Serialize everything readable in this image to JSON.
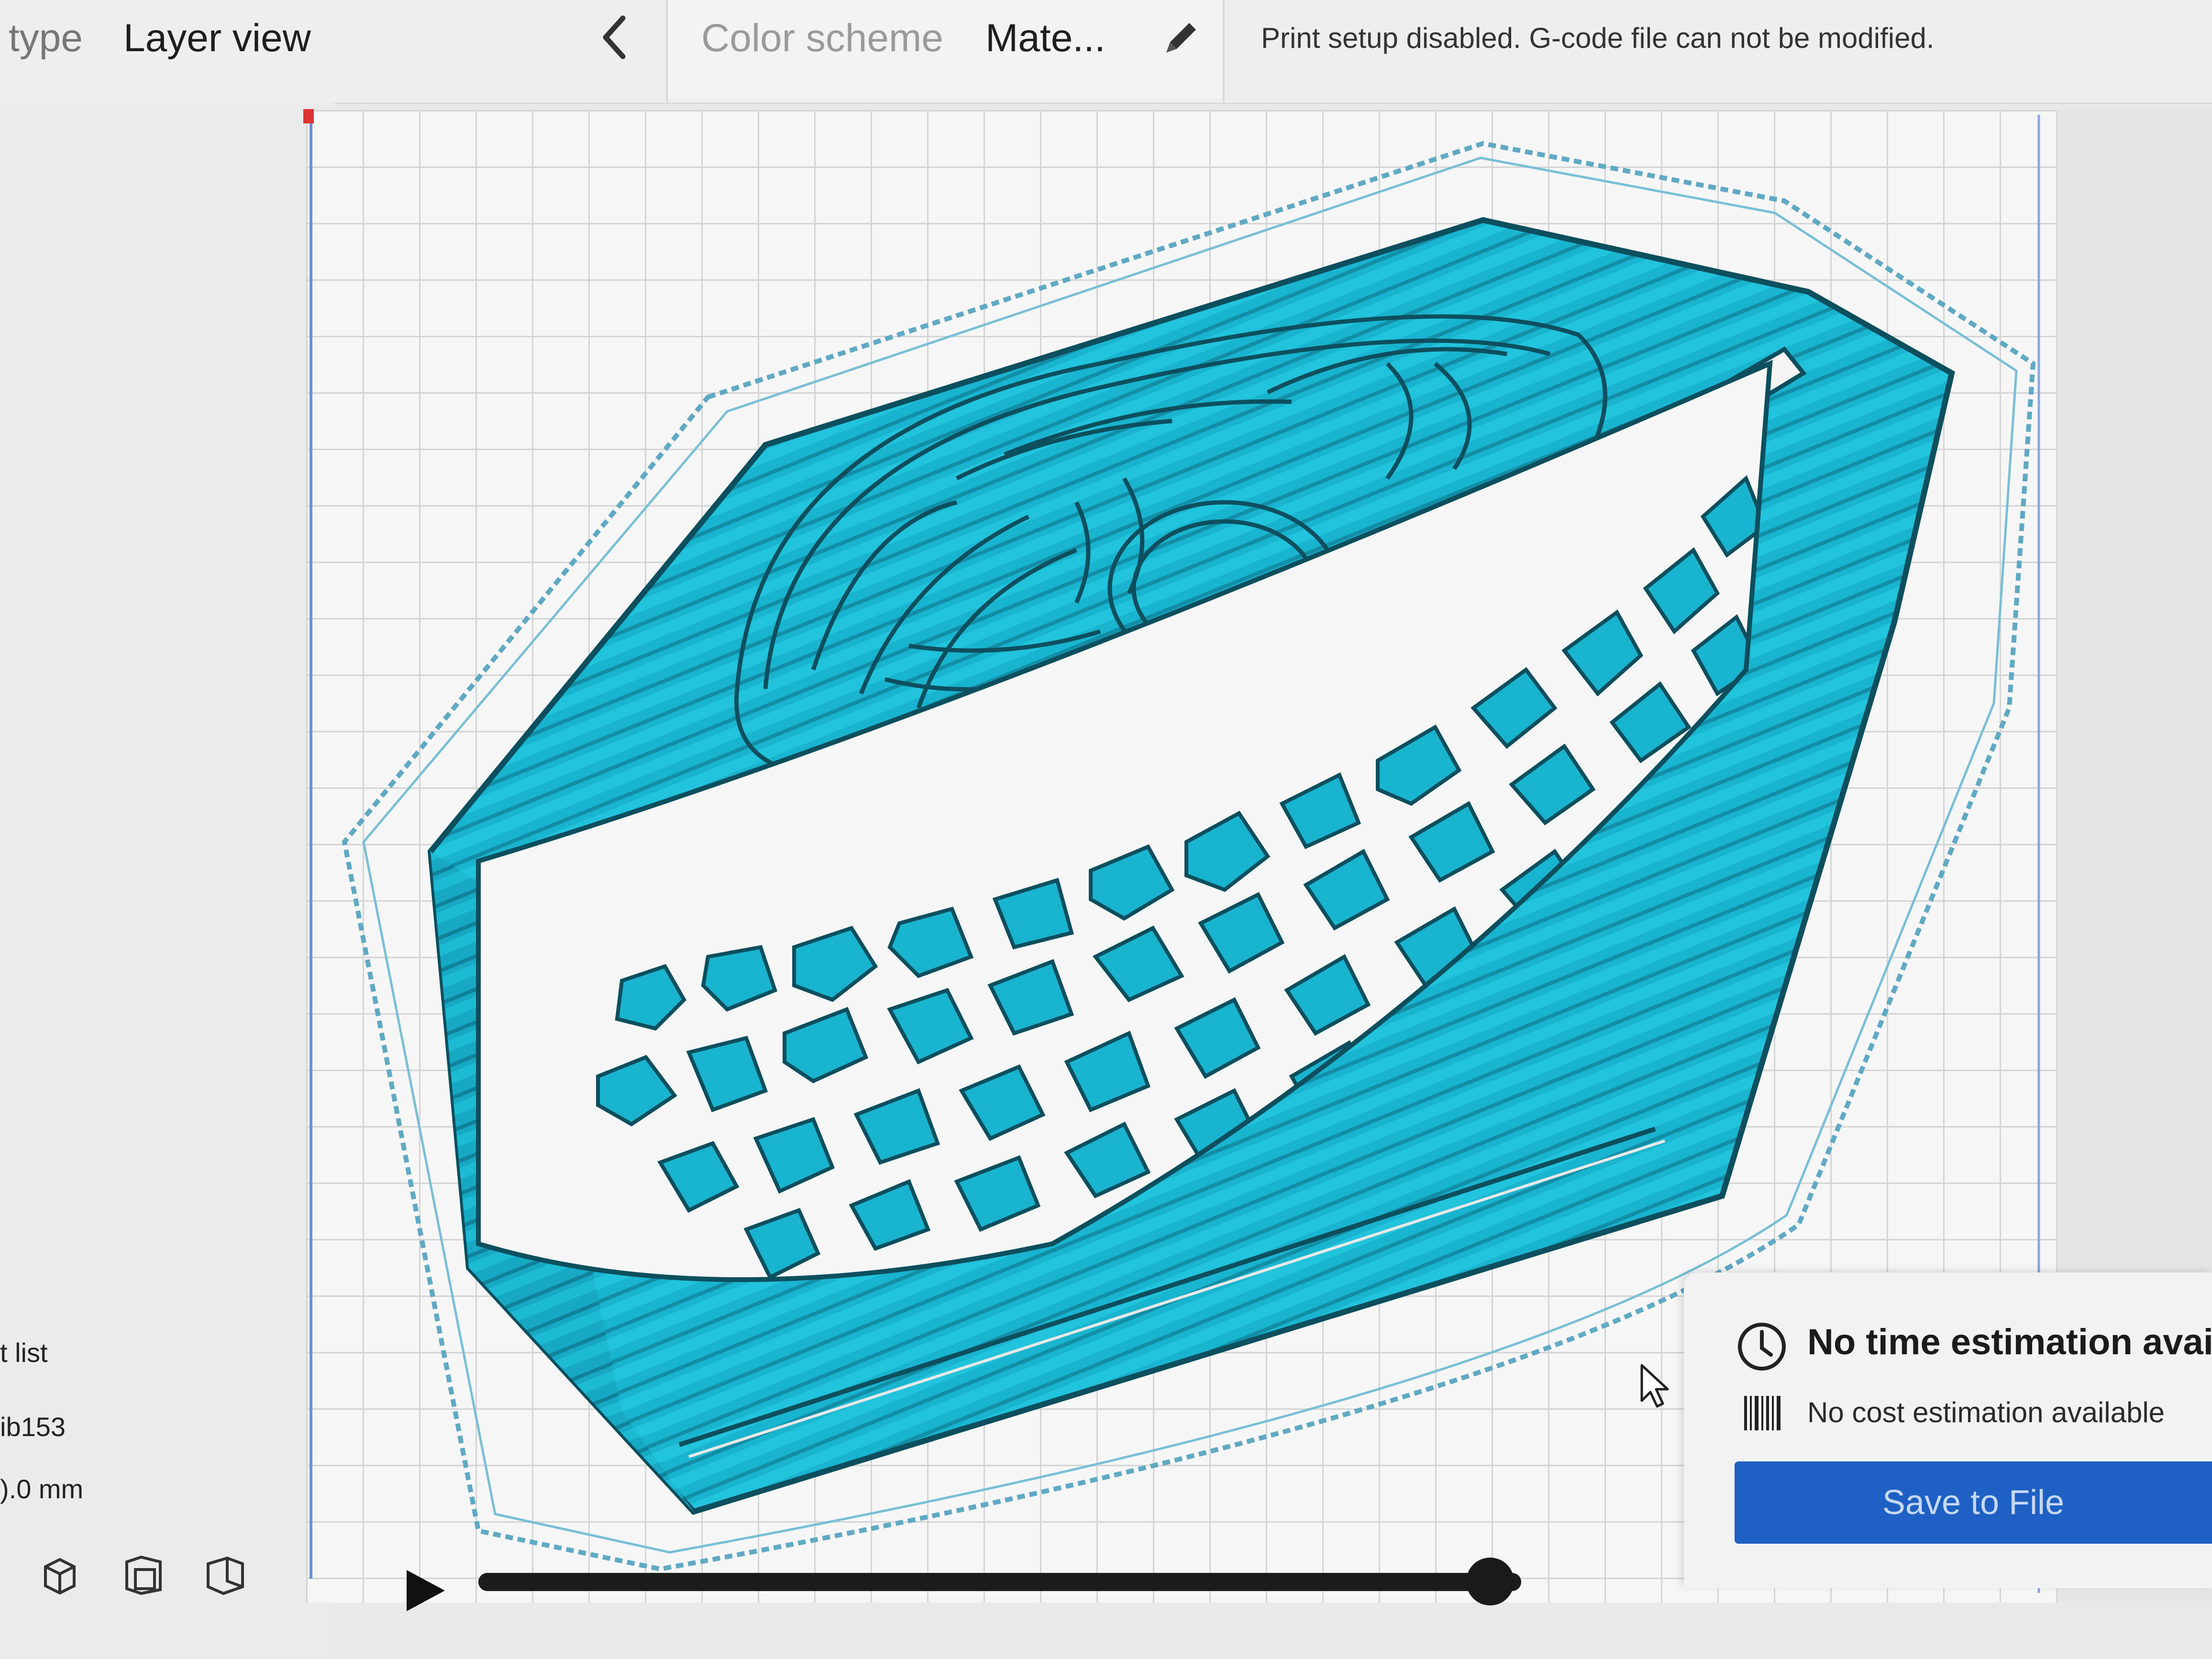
{
  "topbar": {
    "view_type_label": "type",
    "view_type_value": "Layer view",
    "color_scheme_label": "Color scheme",
    "color_scheme_value": "Mate...",
    "status_message": "Print setup disabled. G-code file can not be modified."
  },
  "left_panel": {
    "object_list_label": "t list",
    "object_name": "ib153",
    "object_dims": ").0 mm"
  },
  "layer_slider": {
    "value_fraction": 0.97
  },
  "print_panel": {
    "time_estimate": "No time estimation available",
    "cost_estimate": "No cost estimation available",
    "save_button": "Save to File"
  },
  "colors": {
    "print_cyan": "#19b4cf",
    "print_dark": "#0d4f5e",
    "accent_blue": "#1e60c4"
  }
}
